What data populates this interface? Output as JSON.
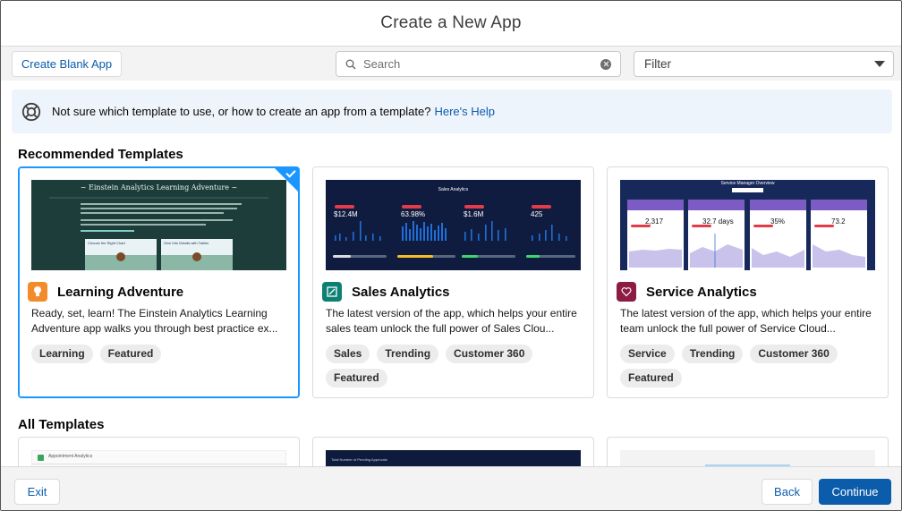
{
  "header": {
    "title": "Create a New App"
  },
  "toolbar": {
    "create_blank_label": "Create Blank App",
    "search_placeholder": "Search",
    "filter_value": "Filter"
  },
  "help_banner": {
    "text": "Not sure which template to use, or how to create an app from a template?",
    "link": "Here's Help"
  },
  "sections": {
    "recommended": "Recommended Templates",
    "all": "All Templates"
  },
  "cards": [
    {
      "title": "Learning Adventure",
      "description": "Ready, set, learn! The Einstein Analytics Learning Adventure app walks you through best practice ex...",
      "tags": [
        "Learning",
        "Featured"
      ],
      "icon": "bulb-icon",
      "icon_color": "#f38b2b",
      "selected": true,
      "thumb_heading": "~ Einstein Analytics Learning Adventure ~",
      "thumb_card_a": "Choose the Right Chart",
      "thumb_card_b": "Give Info Details with Tables"
    },
    {
      "title": "Sales Analytics",
      "description": "The latest version of the app, which helps your entire sales team unlock the full power of Sales Clou...",
      "tags": [
        "Sales",
        "Trending",
        "Customer 360",
        "Featured"
      ],
      "icon": "chart-icon",
      "icon_color": "#0d8074",
      "selected": false,
      "thumb_heading": "Sales Analytics",
      "thumb_kpis": [
        "$12.4M",
        "63.98%",
        "$1.6M",
        "425"
      ]
    },
    {
      "title": "Service Analytics",
      "description": "The latest version of the app, which helps your entire team unlock the full power of Service Cloud...",
      "tags": [
        "Service",
        "Trending",
        "Customer 360",
        "Featured"
      ],
      "icon": "heart-icon",
      "icon_color": "#8c1c43",
      "selected": false,
      "thumb_heading": "Service Manager Overview",
      "thumb_kpis": [
        "2,317",
        "32.7 days",
        "35%",
        "73.2"
      ]
    }
  ],
  "all_templates": [
    {
      "thumb_heading": "Appointment Analytics"
    },
    {
      "thumb_heading": "Total Number of Pending Approvals"
    },
    {
      "thumb_heading": ""
    }
  ],
  "footer": {
    "exit_label": "Exit",
    "back_label": "Back",
    "continue_label": "Continue"
  },
  "colors": {
    "brand": "#0b5cab",
    "selected_border": "#1b96ff",
    "help_bg": "#eef4fb"
  }
}
